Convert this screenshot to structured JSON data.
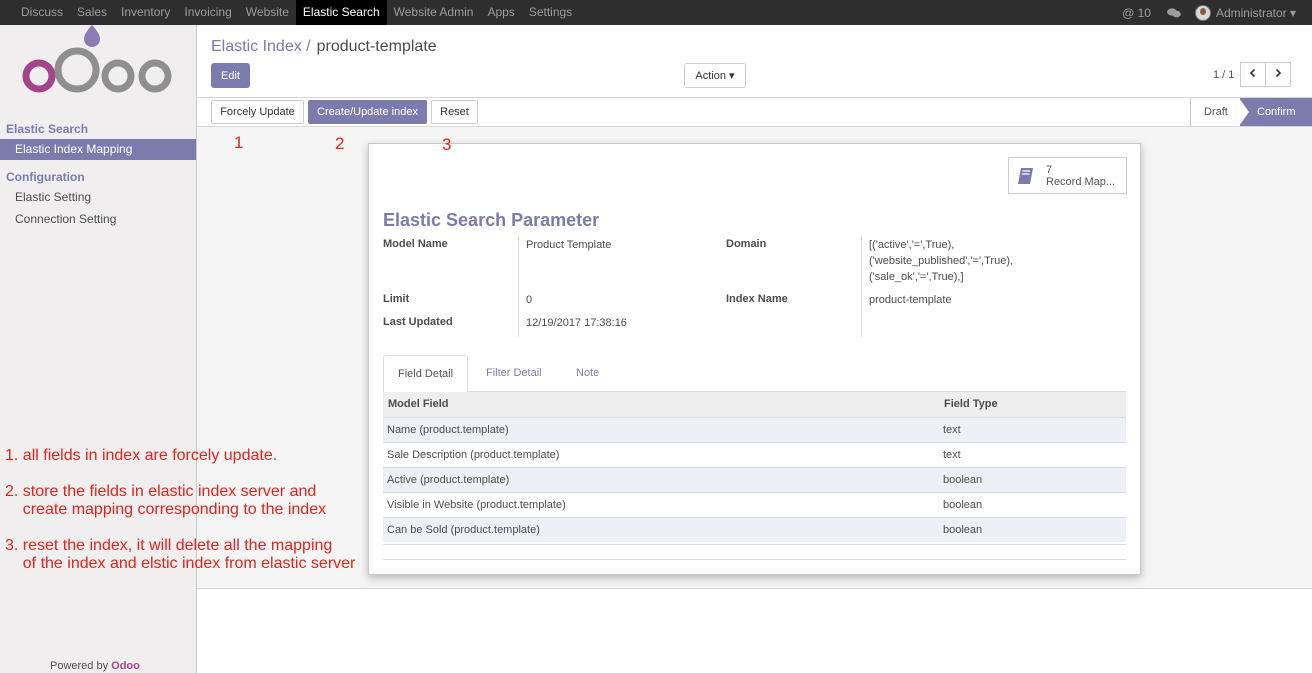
{
  "topbar": {
    "menu": [
      "Discuss",
      "Sales",
      "Inventory",
      "Invoicing",
      "Website",
      "Elastic Search",
      "Website Admin",
      "Apps",
      "Settings"
    ],
    "active": "Elastic Search",
    "notifications": "@ 10",
    "user": "Administrator ▾"
  },
  "sidebar": {
    "section1": "Elastic Search",
    "items1": [
      "Elastic Index Mapping"
    ],
    "section2": "Configuration",
    "items2": [
      "Elastic Setting",
      "Connection Setting"
    ],
    "powered_prefix": "Powered by",
    "powered_brand": "Odoo"
  },
  "control": {
    "breadcrumb_parent": "Elastic Index /",
    "breadcrumb_current": "product-template",
    "edit": "Edit",
    "action": "Action ▾",
    "pager": "1 / 1"
  },
  "statusbar": {
    "forcely_update": "Forcely Update",
    "create_update": "Create/Update index",
    "reset": "Reset",
    "stages": [
      "Draft",
      "Confirm"
    ],
    "current_stage": "Confirm"
  },
  "form": {
    "smart_button": {
      "count": "7",
      "label": "Record Map..."
    },
    "title": "Elastic Search Parameter",
    "model_name_label": "Model Name",
    "model_name": "Product Template",
    "limit_label": "Limit",
    "limit": "0",
    "last_updated_label": "Last Updated",
    "last_updated": "12/19/2017 17:38:16",
    "domain_label": "Domain",
    "domain_lines": [
      "[('active','=',True),",
      "('website_published','=',True),",
      "('sale_ok','=',True),]"
    ],
    "index_name_label": "Index Name",
    "index_name": "product-template"
  },
  "tabs": [
    "Field Detail",
    "Filter Detail",
    "Note"
  ],
  "active_tab": "Field Detail",
  "field_table": {
    "headers": [
      "Model Field",
      "Field Type"
    ],
    "rows": [
      [
        "Name (product.template)",
        "text"
      ],
      [
        "Sale Description (product.template)",
        "text"
      ],
      [
        "Active (product.template)",
        "boolean"
      ],
      [
        "Visible in Website (product.template)",
        "boolean"
      ],
      [
        "Can be Sold (product.template)",
        "boolean"
      ]
    ]
  },
  "annotations": {
    "numbers": [
      "1",
      "2",
      "3"
    ],
    "notes": [
      "1. all fields in index are forcely update.",
      "2. store the fields in elastic index server and",
      "    create mapping corresponding to the index",
      "3. reset the index, it will delete all the mapping",
      "    of the index and elstic index from elastic server"
    ]
  },
  "colors": {
    "brand": "#7c7bad",
    "annotation": "#e0241b",
    "navbar": "#2e2e2e"
  }
}
